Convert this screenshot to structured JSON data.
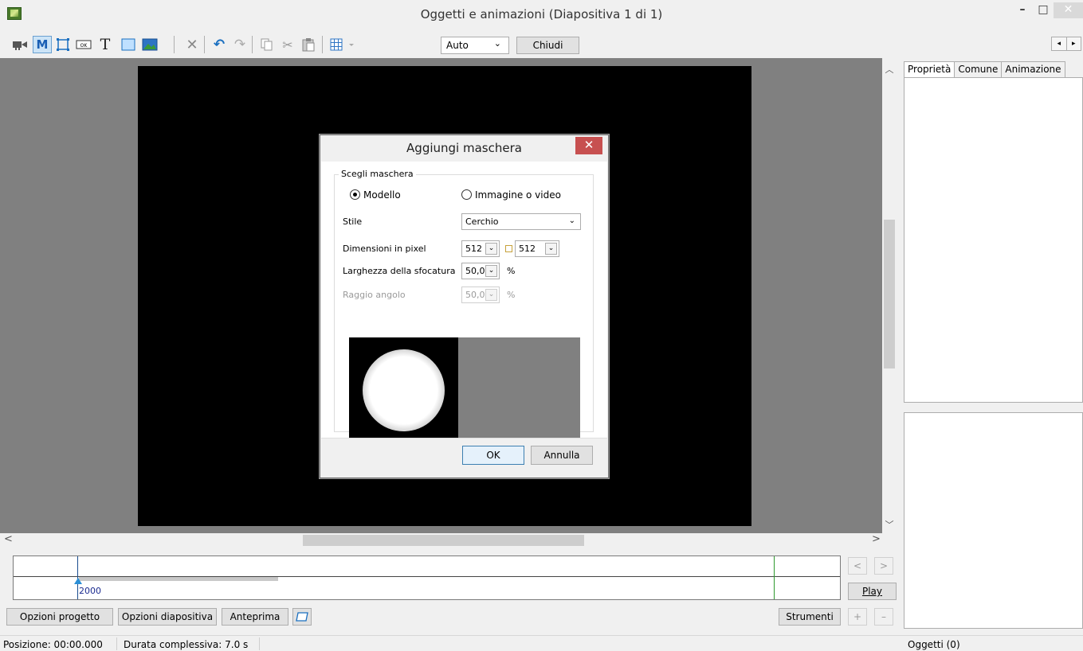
{
  "window": {
    "title": "Oggetti e animazioni  (Diapositiva 1 di 1)",
    "minimize": "–",
    "maximize": "□",
    "close": "✕"
  },
  "toolbar": {
    "zoom_value": "Auto",
    "zoom_arrow": "⌄",
    "close_label": "Chiudi",
    "text_tool": "T",
    "mask_tool": "M",
    "scroll_left": "◂",
    "scroll_right": "▸"
  },
  "dialog": {
    "title": "Aggiungi maschera",
    "close": "✕",
    "group_label": "Scegli maschera",
    "radio_model": "Modello",
    "radio_image": "Immagine o video",
    "style_label": "Stile",
    "style_value": "Cerchio",
    "size_label": "Dimensioni in pixel",
    "size_width": "512",
    "size_height": "512",
    "blur_label": "Larghezza della sfocatura",
    "blur_value": "50,00",
    "blur_unit": "%",
    "radius_label": "Raggio angolo",
    "radius_value": "50,00",
    "radius_unit": "%",
    "ok": "OK",
    "cancel": "Annulla"
  },
  "right_panel": {
    "tabs": [
      {
        "label": "Proprietà"
      },
      {
        "label": "Comune"
      },
      {
        "label": "Animazione"
      }
    ]
  },
  "timeline": {
    "cursor_value": "2000",
    "prev": "<",
    "next": ">",
    "play": "Play",
    "add": "+",
    "remove": "–"
  },
  "bottom_buttons": {
    "project_options": "Opzioni progetto",
    "slide_options": "Opzioni diapositiva",
    "preview": "Anteprima",
    "tools": "Strumenti"
  },
  "status": {
    "position": "Posizione:  00:00.000",
    "duration": "Durata complessiva:  7.0 s",
    "objects": "Oggetti (0)"
  },
  "colors": {
    "canvas_bg": "#808080",
    "slide_bg": "#000000",
    "dialog_close": "#c75050",
    "timeline_end": "#2e9a2e",
    "timeline_marker": "#2b8fd6"
  },
  "icons": [
    "camera-icon",
    "mask-icon",
    "frame-icon",
    "button-icon",
    "text-icon",
    "rectangle-icon",
    "image-icon",
    "delete-icon",
    "undo-icon",
    "redo-icon",
    "copy-icon",
    "cut-icon",
    "paste-icon",
    "grid-icon"
  ]
}
